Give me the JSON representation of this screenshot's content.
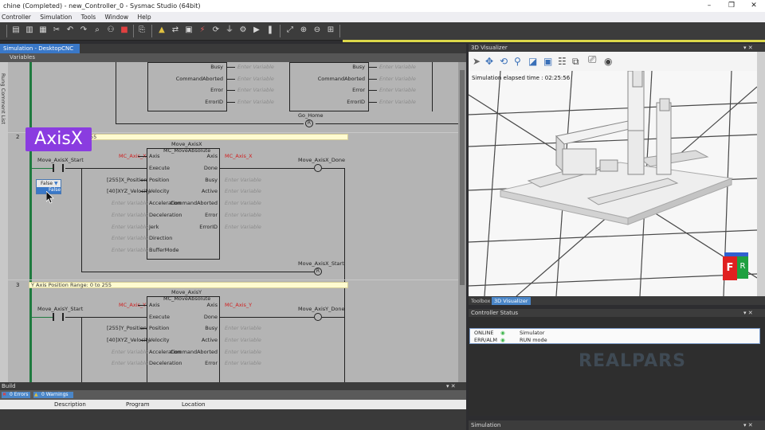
{
  "window": {
    "title": "chine (Completed) - new_Controller_0 - Sysmac Studio (64bit)",
    "minimize": "–",
    "maximize": "❐",
    "close": "✕"
  },
  "menu": [
    "Controller",
    "Simulation",
    "Tools",
    "Window",
    "Help"
  ],
  "editor": {
    "tab_label": "Simulation - DesktopCNC",
    "variables_label": "Variables",
    "side_label": "Rung Comment List",
    "overlay_badge": "AxisX",
    "rung1": {
      "outputs": [
        "Busy",
        "CommandAborted",
        "Error",
        "ErrorID"
      ],
      "outputs2": [
        "Busy",
        "CommandAborted",
        "Error",
        "ErrorID"
      ],
      "coil_label": "Go_Home",
      "coil_symbol": "R"
    },
    "rung2": {
      "number": "2",
      "comment": "55",
      "instance": "Move_AxisX",
      "block": "MC_MoveAbsolute",
      "contact": "Move_AxisX_Start",
      "axis_var": "MC_Axis_X",
      "axis_out": "MC_Axis_X",
      "pos_val": "[255]X_Position",
      "vel_val": "[40]XYZ_Velocity",
      "inputs": [
        "Axis",
        "Execute",
        "Position",
        "Velocity",
        "Acceleration",
        "Deceleration",
        "Jerk",
        "Direction",
        "BufferMode"
      ],
      "outputs": [
        "Axis",
        "Done",
        "Busy",
        "Active",
        "CommandAborted",
        "Error",
        "ErrorID"
      ],
      "done_coil": "Move_AxisX_Done",
      "reset_coil": "Move_AxisX_Start",
      "coil_symbol": "R",
      "placeholder": "Enter Variable",
      "dropdown_value": "False",
      "dropdown_option": "False"
    },
    "rung3": {
      "number": "3",
      "comment": "Y Axis Position Range: 0 to 255",
      "instance": "Move_AxisY",
      "block": "MC_MoveAbsolute",
      "contact": "Move_AxisY_Start",
      "axis_var": "MC_Axis_Y",
      "axis_out": "MC_Axis_Y",
      "pos_val": "[255]Y_Position",
      "vel_val": "[40]XYZ_Velocity",
      "inputs": [
        "Axis",
        "Execute",
        "Position",
        "Velocity",
        "Acceleration",
        "Deceleration"
      ],
      "outputs": [
        "Axis",
        "Done",
        "Busy",
        "Active",
        "CommandAborted",
        "Error"
      ],
      "done_coil": "Move_AxisY_Done",
      "placeholder": "Enter Variable"
    }
  },
  "build": {
    "title": "Build",
    "filters": [
      "0 Errors",
      "0 Warnings"
    ],
    "columns": [
      "Description",
      "Program",
      "Location"
    ]
  },
  "visualizer": {
    "title": "3D Visualizer",
    "elapsed_label": "Simulation elapsed time : 02:25:56",
    "tabs": [
      "Toolbox",
      "3D Visualizer"
    ],
    "active_tab": "3D Visualizer",
    "cube_letters": [
      "F",
      "R"
    ]
  },
  "controller_status": {
    "title": "Controller Status",
    "rows": [
      {
        "label": "ONLINE",
        "value": "Simulator"
      },
      {
        "label": "ERR/ALM",
        "value": "RUN mode"
      }
    ]
  },
  "simulation_panel": {
    "title": "Simulation"
  },
  "watermark": "REALPARS",
  "colors": {
    "rail": "#1f7a3f",
    "badge": "#8a3ce0",
    "tab_active": "#3a78c8",
    "status_ok": "#3cb44a",
    "cube_front": "#e02020",
    "cube_side": "#1fa040"
  }
}
